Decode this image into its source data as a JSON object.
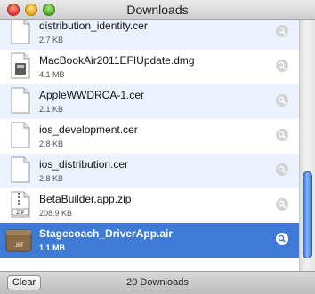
{
  "window": {
    "title": "Downloads"
  },
  "downloads": [
    {
      "name": "distribution_identity.cer",
      "size": "2.7 KB",
      "icon": "document-icon"
    },
    {
      "name": "MacBookAir2011EFIUpdate.dmg",
      "size": "4.1 MB",
      "icon": "disk-image-icon"
    },
    {
      "name": "AppleWWDRCA-1.cer",
      "size": "2.1 KB",
      "icon": "document-icon"
    },
    {
      "name": "ios_development.cer",
      "size": "2.8 KB",
      "icon": "document-icon"
    },
    {
      "name": "ios_distribution.cer",
      "size": "2.8 KB",
      "icon": "document-icon"
    },
    {
      "name": "BetaBuilder.app.zip",
      "size": "208.9 KB",
      "icon": "zip-icon"
    },
    {
      "name": "Stagecoach_DriverApp.air",
      "size": "1.1 MB",
      "icon": "air-package-icon",
      "selected": true
    }
  ],
  "zip_label": "ZIP",
  "air_label": ".air",
  "footer": {
    "clear_label": "Clear",
    "count_label": "20 Downloads"
  },
  "colors": {
    "selection": "#3d7bd6",
    "alt_row": "#edf3fe"
  }
}
